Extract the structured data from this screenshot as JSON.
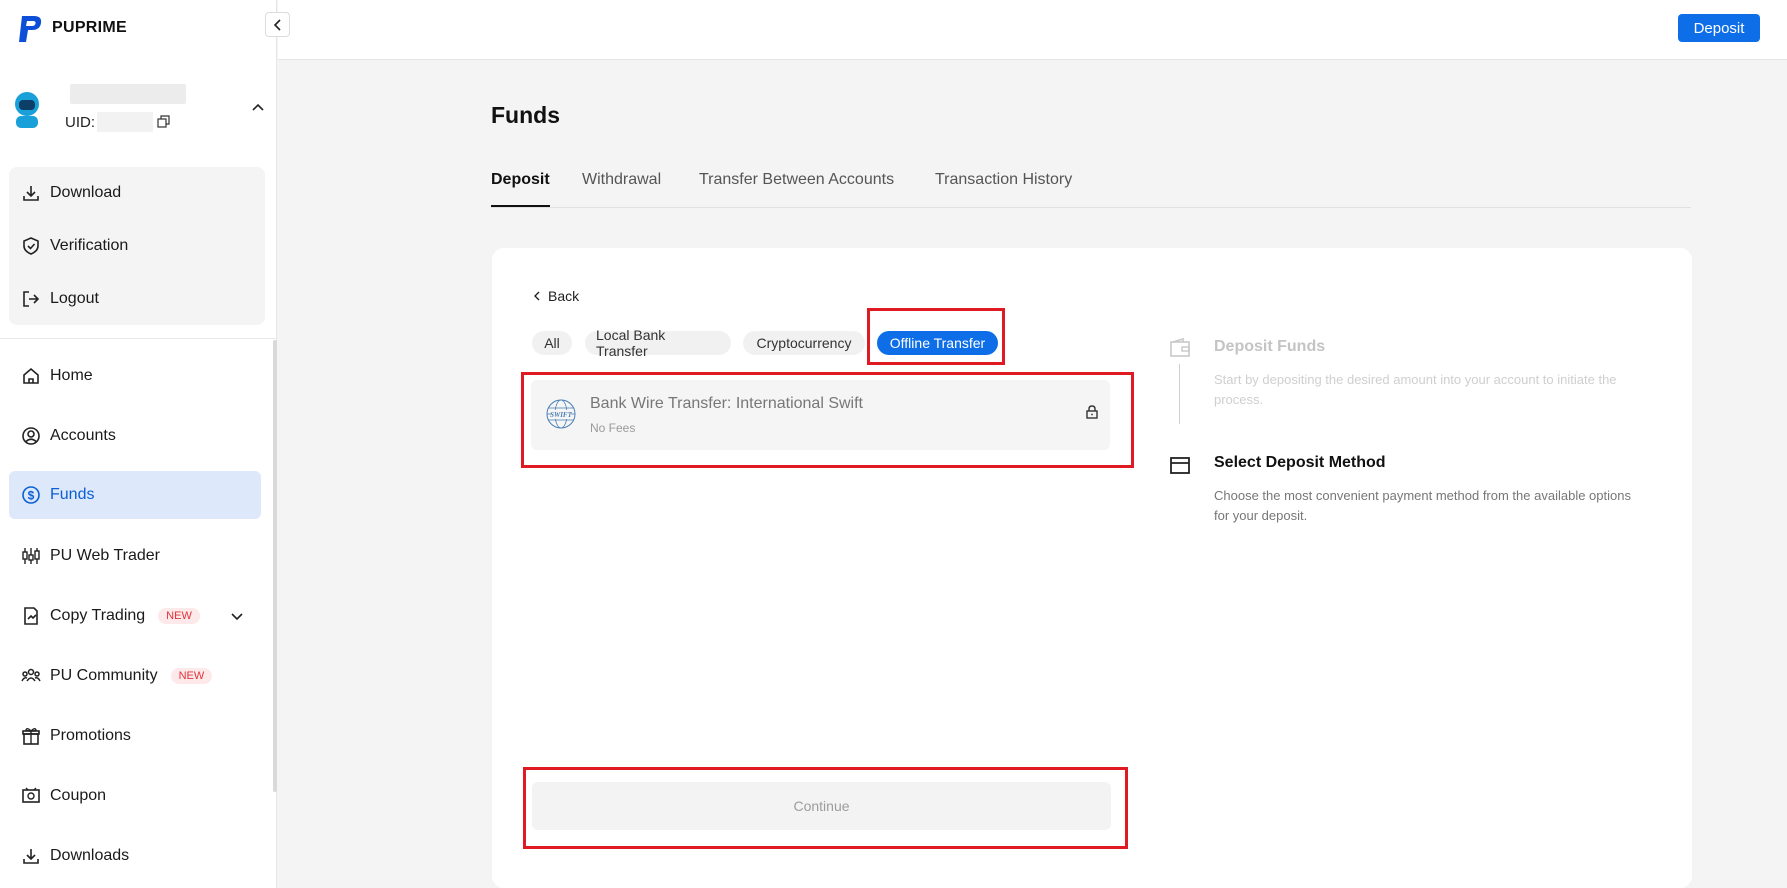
{
  "brand": {
    "name": "PUPRIME"
  },
  "user": {
    "uid_label": "UID:"
  },
  "account_menu": [
    {
      "label": "Download",
      "icon": "download-icon"
    },
    {
      "label": "Verification",
      "icon": "shield-check-icon"
    },
    {
      "label": "Logout",
      "icon": "logout-icon"
    }
  ],
  "nav": [
    {
      "label": "Home",
      "icon": "home-icon"
    },
    {
      "label": "Accounts",
      "icon": "user-circle-icon"
    },
    {
      "label": "Funds",
      "icon": "dollar-circle-icon",
      "active": true
    },
    {
      "label": "PU Web Trader",
      "icon": "candlestick-icon"
    },
    {
      "label": "Copy Trading",
      "icon": "copy-trading-icon",
      "badge": "NEW"
    },
    {
      "label": "PU Community",
      "icon": "community-icon",
      "badge": "NEW"
    },
    {
      "label": "Promotions",
      "icon": "gift-icon"
    },
    {
      "label": "Coupon",
      "icon": "coupon-icon"
    },
    {
      "label": "Downloads",
      "icon": "download-icon"
    }
  ],
  "header": {
    "deposit_button": "Deposit"
  },
  "page": {
    "title": "Funds"
  },
  "tabs": [
    "Deposit",
    "Withdrawal",
    "Transfer Between Accounts",
    "Transaction History"
  ],
  "back_label": "Back",
  "filters": [
    "All",
    "Local Bank Transfer",
    "Cryptocurrency",
    "Offline Transfer"
  ],
  "active_filter": "Offline Transfer",
  "method": {
    "name": "Bank Wire Transfer: International Swift",
    "fee": "No Fees",
    "logo_text": "SWIFT"
  },
  "continue_label": "Continue",
  "steps": [
    {
      "title": "Deposit Funds",
      "desc": "Start by depositing the desired amount into your account to initiate the process."
    },
    {
      "title": "Select Deposit Method",
      "desc": "Choose the most convenient payment method from the available options for your deposit."
    }
  ],
  "colors": {
    "accent": "#0d6ee8",
    "highlight": "#e01a23",
    "active_nav_bg": "#dde9fb"
  }
}
